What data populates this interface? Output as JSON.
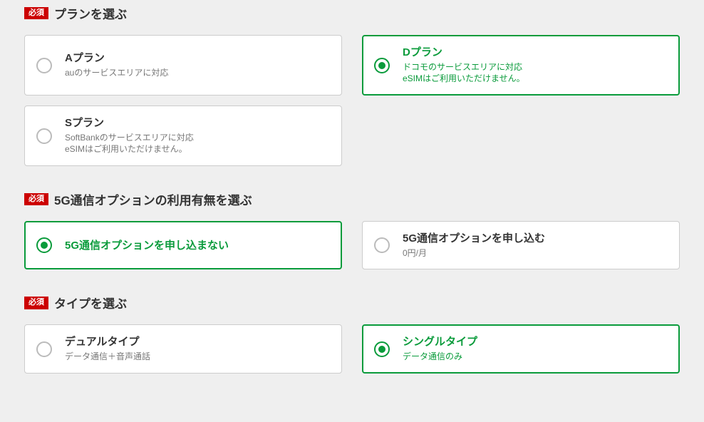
{
  "required_label": "必須",
  "sections": {
    "plan": {
      "title": "プランを選ぶ",
      "options": [
        {
          "title": "Aプラン",
          "desc": "auのサービスエリアに対応",
          "selected": false
        },
        {
          "title": "Dプラン",
          "desc": "ドコモのサービスエリアに対応\neSIMはご利用いただけません。",
          "selected": true
        },
        {
          "title": "Sプラン",
          "desc": "SoftBankのサービスエリアに対応\neSIMはご利用いただけません。",
          "selected": false
        }
      ]
    },
    "fiveg": {
      "title": "5G通信オプションの利用有無を選ぶ",
      "options": [
        {
          "title": "5G通信オプションを申し込まない",
          "desc": "",
          "selected": true
        },
        {
          "title": "5G通信オプションを申し込む",
          "desc": "0円/月",
          "selected": false
        }
      ]
    },
    "type": {
      "title": "タイプを選ぶ",
      "options": [
        {
          "title": "デュアルタイプ",
          "desc": "データ通信＋音声通話",
          "selected": false
        },
        {
          "title": "シングルタイプ",
          "desc": "データ通信のみ",
          "selected": true
        }
      ]
    }
  }
}
